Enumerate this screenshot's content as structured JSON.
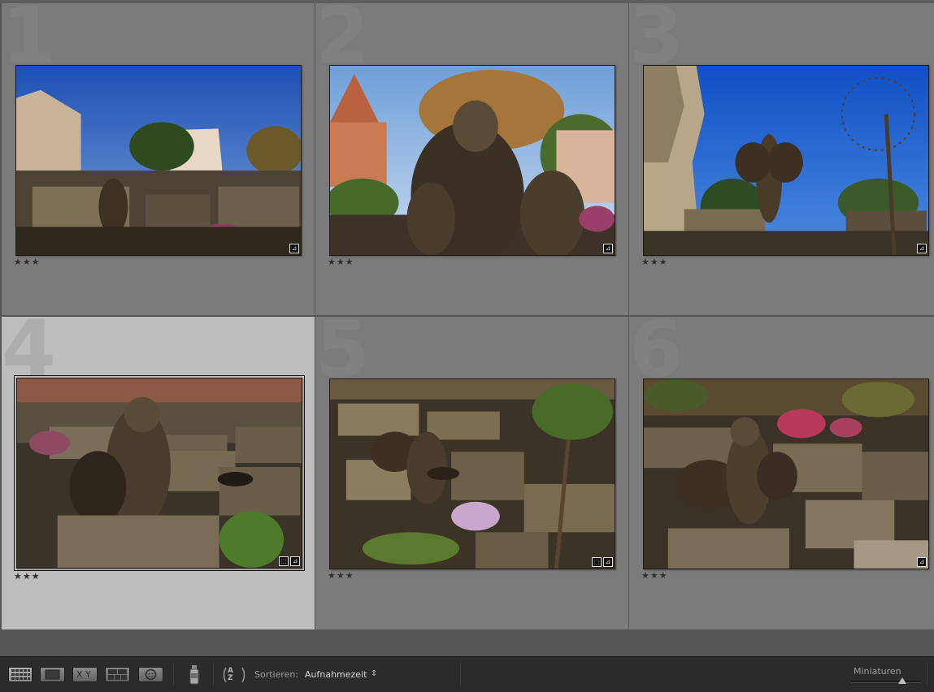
{
  "grid": {
    "cells": [
      {
        "number": "1",
        "rating": "★★★",
        "badges": [
          "edit"
        ],
        "selected": false
      },
      {
        "number": "2",
        "rating": "★★★",
        "badges": [
          "edit"
        ],
        "selected": false
      },
      {
        "number": "3",
        "rating": "★★★",
        "badges": [
          "edit"
        ],
        "selected": false
      },
      {
        "number": "4",
        "rating": "★★★",
        "badges": [
          "crop",
          "edit"
        ],
        "selected": true
      },
      {
        "number": "5",
        "rating": "★★★",
        "badges": [
          "crop",
          "edit"
        ],
        "selected": false
      },
      {
        "number": "6",
        "rating": "★★★",
        "badges": [
          "edit"
        ],
        "selected": false
      }
    ]
  },
  "toolbar": {
    "sort_label": "Sortieren:",
    "sort_value": "Aufnahmezeit",
    "sort_chevron": "⇕",
    "compare_label": "X Y",
    "sort_az_label": "A Z",
    "thumbnail_label": "Miniaturen",
    "thumbnail_size": 0.73,
    "icons": [
      "grid-view-icon",
      "loupe-view-icon",
      "compare-view-icon",
      "survey-view-icon",
      "people-view-icon",
      "painter-spray-icon",
      "sort-direction-icon"
    ]
  },
  "colors": {
    "grid_bg": "#7b7b7b",
    "selected_bg": "#bdbdbd",
    "toolbar_bg": "#2b2b2b"
  }
}
